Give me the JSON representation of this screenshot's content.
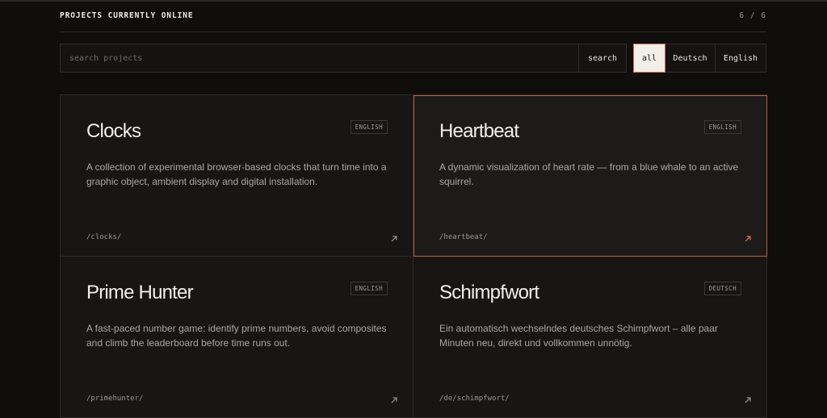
{
  "header": {
    "title": "PROJECTS CURRENTLY ONLINE",
    "count": "6 / 6"
  },
  "search": {
    "placeholder": "search projects",
    "value": "",
    "button_label": "search"
  },
  "filters": [
    {
      "label": "all",
      "active": true
    },
    {
      "label": "Deutsch",
      "active": false
    },
    {
      "label": "English",
      "active": false
    }
  ],
  "colors": {
    "accent": "#d56a4b",
    "background": "#0f0e0d",
    "card": "#171615"
  },
  "projects": [
    {
      "title": "Clocks",
      "badge": "ENGLISH",
      "description": "A collection of experimental browser-based clocks that turn time into a graphic object, ambient display and digital installation.",
      "path": "/clocks/",
      "icon": "arrow-up-right-icon"
    },
    {
      "title": "Heartbeat",
      "badge": "ENGLISH",
      "description": "A dynamic visualization of heart rate — from a blue whale to an active squirrel.",
      "path": "/heartbeat/",
      "icon": "arrow-up-right-icon"
    },
    {
      "title": "Prime Hunter",
      "badge": "ENGLISH",
      "description": "A fast-paced number game: identify prime numbers, avoid composites and climb the leaderboard before time runs out.",
      "path": "/primehunter/",
      "icon": "arrow-up-right-icon"
    },
    {
      "title": "Schimpfwort",
      "badge": "DEUTSCH",
      "description": "Ein automatisch wechselndes deutsches Schimpfwort – alle paar Minuten neu, direkt und vollkommen unnötig.",
      "path": "/de/schimpfwort/",
      "icon": "arrow-up-right-icon"
    }
  ]
}
